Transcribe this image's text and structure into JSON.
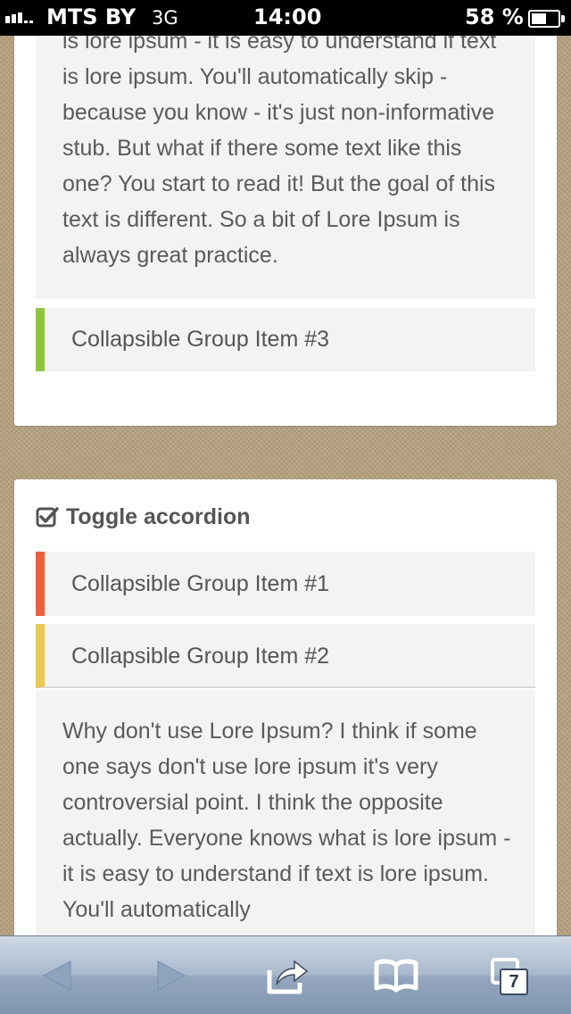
{
  "status_bar": {
    "carrier": "MTS BY",
    "network": "3G",
    "time": "14:00",
    "battery": "58 %",
    "battery_level": 0.58
  },
  "accordion_top": {
    "body_text": "is lore ipsum - it is easy to understand if text is lore ipsum. You'll automatically skip - because you know - it's just non-informative stub. But what if there some text like this one? You start to read it! But the goal of this text is different. So a bit of Lore Ipsum is always great practice.",
    "item3_label": "Collapsible Group Item #3",
    "item3_color": "#8cc63f"
  },
  "toggle_accordion": {
    "title": "Toggle accordion",
    "title_icon": "check-square-icon",
    "item1_label": "Collapsible Group Item #1",
    "item1_color": "#e8603c",
    "item2_label": "Collapsible Group Item #2",
    "item2_color": "#ebc857",
    "body_text": "Why don't use Lore Ipsum? I think if some one says don't use lore ipsum it's very controversial point. I think the opposite actually. Everyone knows what is lore ipsum - it is easy to understand if text is lore ipsum. You'll automatically"
  },
  "browser_toolbar": {
    "back_icon": "back-arrow-icon",
    "forward_icon": "forward-arrow-icon",
    "share_icon": "share-icon",
    "bookmarks_icon": "bookmarks-icon",
    "tabs_icon": "tabs-icon",
    "tab_count": "7"
  }
}
